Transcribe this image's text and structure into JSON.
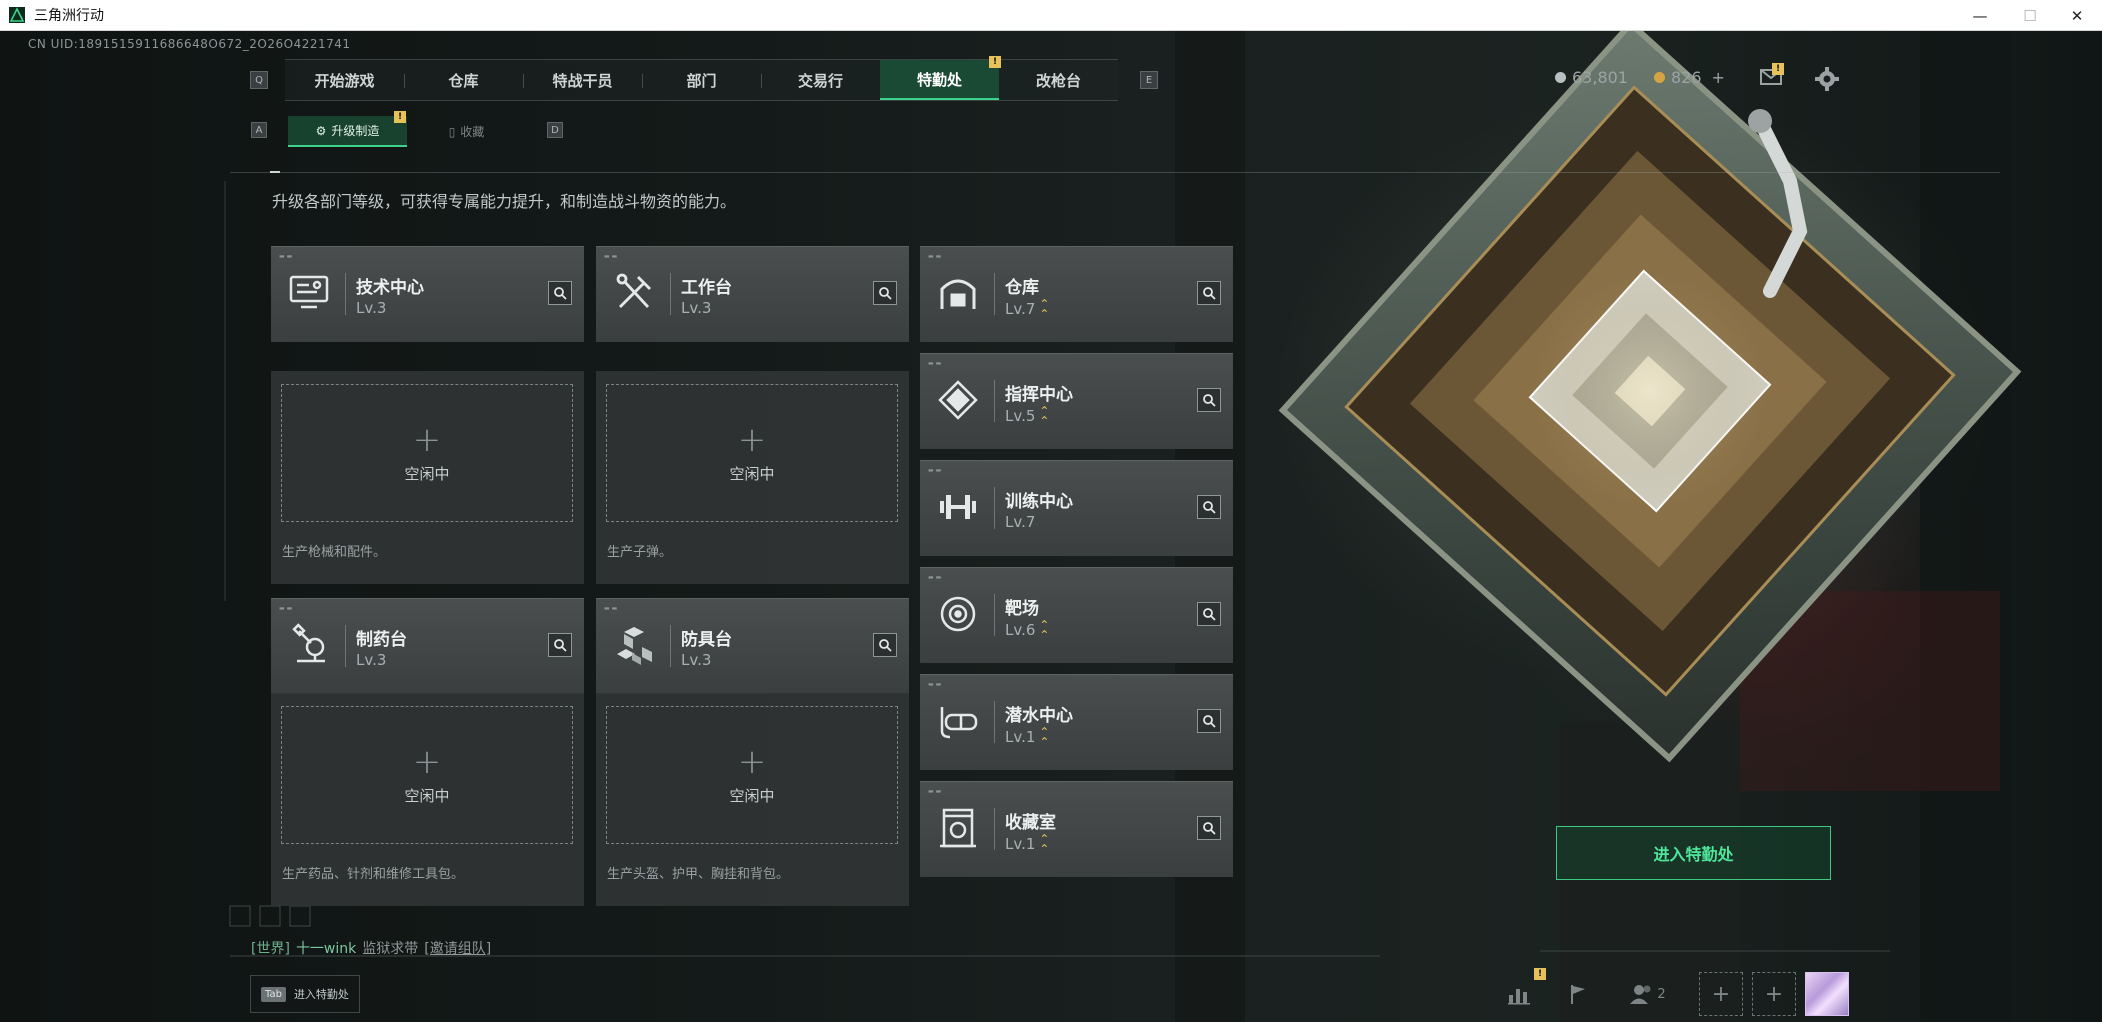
{
  "window": {
    "title": "三角洲行动",
    "controls": [
      "—",
      "☐",
      "✕"
    ]
  },
  "uid": "CN UID:1891515911686648O672_2O26O4221741",
  "nav": {
    "left_key": "Q",
    "right_key": "E",
    "tabs": [
      "开始游戏",
      "仓库",
      "特战干员",
      "部门",
      "交易行",
      "特勤处",
      "改枪台"
    ],
    "active_tab": "特勤处",
    "badge": "!"
  },
  "subnav": {
    "left_key": "A",
    "right_key": "D",
    "tabs": [
      "升级制造",
      "收藏"
    ],
    "active": "升级制造",
    "badge": "!"
  },
  "description": "升级各部门等级，可获得专属能力提升，和制造战斗物资的能力。",
  "workshops": [
    {
      "name": "技术中心",
      "level": "Lv.3",
      "icon": "tech-center-icon",
      "slot_label": "空闲中",
      "slot_plus": "+",
      "desc": "生产枪械和配件。"
    },
    {
      "name": "工作台",
      "level": "Lv.3",
      "icon": "workbench-icon",
      "slot_label": "空闲中",
      "slot_plus": "+",
      "desc": "生产子弹。"
    },
    {
      "name": "制药台",
      "level": "Lv.3",
      "icon": "pharmacy-icon",
      "slot_label": "空闲中",
      "slot_plus": "+",
      "desc": "生产药品、针剂和维修工具包。"
    },
    {
      "name": "防具台",
      "level": "Lv.3",
      "icon": "armor-bench-icon",
      "slot_label": "空闲中",
      "slot_plus": "+",
      "desc": "生产头盔、护甲、胸挂和背包。"
    }
  ],
  "facilities": [
    {
      "name": "仓库",
      "level": "Lv.7",
      "upgradable": true,
      "icon": "warehouse-icon"
    },
    {
      "name": "指挥中心",
      "level": "Lv.5",
      "upgradable": true,
      "icon": "command-center-icon"
    },
    {
      "name": "训练中心",
      "level": "Lv.7",
      "upgradable": false,
      "icon": "training-center-icon"
    },
    {
      "name": "靶场",
      "level": "Lv.6",
      "upgradable": true,
      "icon": "shooting-range-icon"
    },
    {
      "name": "潜水中心",
      "level": "Lv.1",
      "upgradable": true,
      "icon": "diving-center-icon"
    },
    {
      "name": "收藏室",
      "level": "Lv.1",
      "upgradable": true,
      "icon": "collection-room-icon"
    }
  ],
  "currency": {
    "primary": "63,801",
    "secondary": "826",
    "add": "+",
    "primary_color": "#b9c0c2",
    "secondary_color": "#d3a441"
  },
  "chat": {
    "channel": "[世界]",
    "player": "十一wink",
    "message": "监狱求带",
    "invite": "[邀请组队]"
  },
  "tab_hint": {
    "key": "Tab",
    "label": "进入特勤处"
  },
  "enter_button": "进入特勤处",
  "bottom_bar": {
    "friends_count": "2",
    "badge": "!"
  },
  "colors": {
    "accent": "#3ed38c",
    "warning": "#e7c15a"
  }
}
